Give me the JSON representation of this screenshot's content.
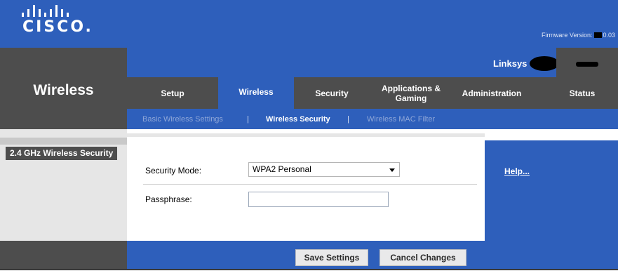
{
  "brand": {
    "logo_text": "CISCO.",
    "product_name": "Linksys",
    "firmware_label": "Firmware Version:",
    "firmware_value": "0.03"
  },
  "section_title": "Wireless",
  "tabs": [
    {
      "label": "Setup",
      "active": false
    },
    {
      "label": "Wireless",
      "active": true
    },
    {
      "label": "Security",
      "active": false
    },
    {
      "label": "Applications & Gaming",
      "active": false
    },
    {
      "label": "Administration",
      "active": false
    },
    {
      "label": "Status",
      "active": false
    }
  ],
  "subtabs": [
    {
      "label": "Basic Wireless Settings",
      "active": false
    },
    {
      "label": "Wireless Security",
      "active": true
    },
    {
      "label": "Wireless MAC Filter",
      "active": false
    }
  ],
  "subtab_separator": "|",
  "side_label": "2.4 GHz Wireless Security",
  "form": {
    "security_mode_label": "Security Mode:",
    "security_mode_value": "WPA2 Personal",
    "passphrase_label": "Passphrase:",
    "passphrase_value": ""
  },
  "help_link": "Help...",
  "buttons": {
    "save": "Save Settings",
    "cancel": "Cancel Changes"
  },
  "colors": {
    "brand_blue": "#2e5fbb",
    "dark_gray": "#4d4d4d",
    "light_gray": "#e6e6e6"
  }
}
